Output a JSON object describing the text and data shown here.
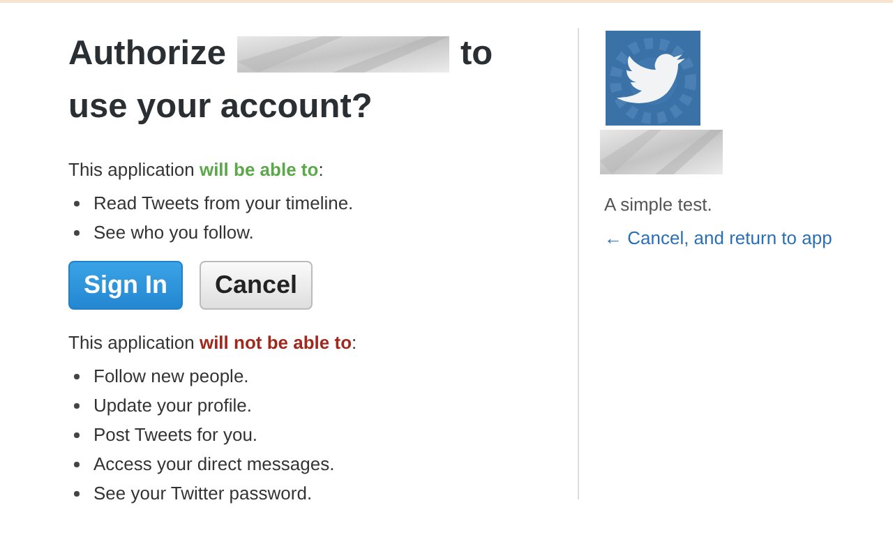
{
  "heading": {
    "lead": "Authorize",
    "tail": "to",
    "line2": "use your account?"
  },
  "sections": [
    {
      "kind": "allowed",
      "intro": "This application **will be able to**:",
      "items": [
        "Read Tweets from your timeline.",
        "See who you follow."
      ]
    },
    {
      "kind": "denied",
      "intro": "This application **will not be able to**:",
      "items": [
        "Follow new people.",
        "Update your profile.",
        "Post Tweets for you.",
        "Access your direct messages.",
        "See your Twitter password."
      ]
    }
  ],
  "buttons": [
    {
      "kind": "primary",
      "label": "Sign In"
    },
    {
      "kind": "secondary",
      "label": "Cancel"
    }
  ],
  "app": {
    "description": "A simple test.",
    "back_link": "← Cancel, and return to app"
  }
}
